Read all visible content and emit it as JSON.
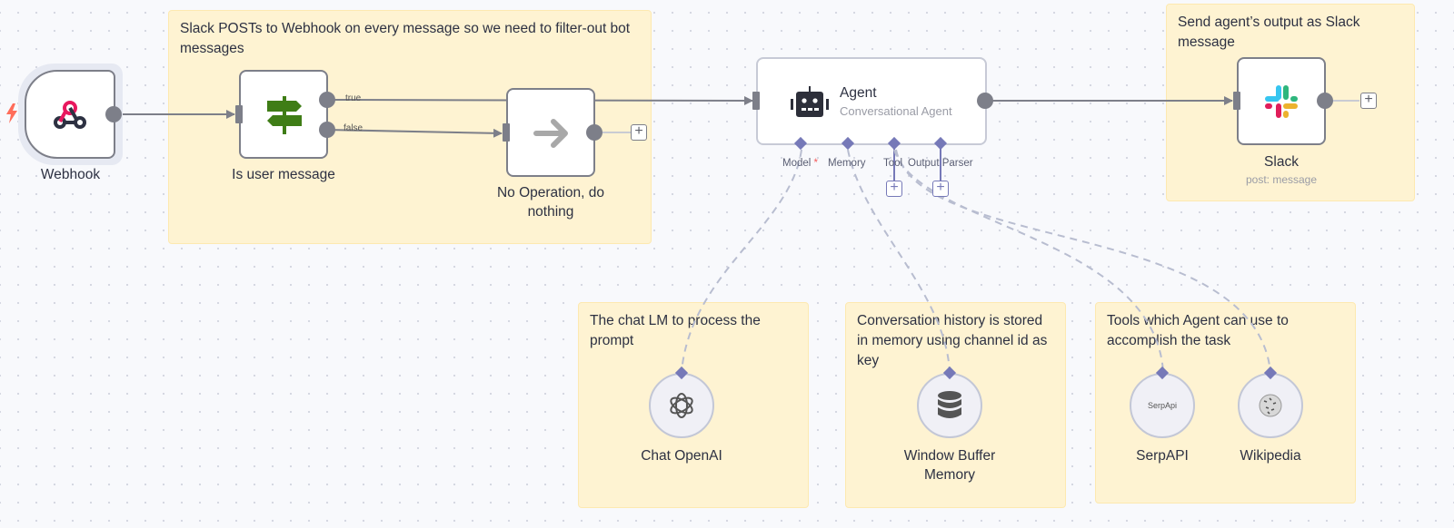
{
  "stickies": {
    "filter_note": "Slack POSTs to Webhook on every message so we need to filter-out bot messages",
    "slack_note": "Send agent’s output as Slack message",
    "model_note": "The chat LM to process the prompt",
    "memory_note": "Conversation history is stored in memory using channel id as key",
    "tools_note": "Tools which Agent can use to accomplish the task"
  },
  "nodes": {
    "webhook": {
      "label": "Webhook",
      "icon": "webhook-icon"
    },
    "if": {
      "label": "Is user message",
      "icon": "signpost-icon",
      "outputs": [
        "true",
        "false"
      ]
    },
    "noop": {
      "label": "No Operation, do nothing",
      "icon": "arrow-right-icon"
    },
    "agent": {
      "label": "Agent",
      "subtitle": "Conversational Agent",
      "icon": "robot-icon",
      "inputs": [
        {
          "label": "Model",
          "required_mark": "*"
        },
        {
          "label": "Memory"
        },
        {
          "label": "Tool"
        },
        {
          "label": "Output Parser"
        }
      ]
    },
    "slack": {
      "label": "Slack",
      "subtitle": "post: message",
      "icon": "slack-icon"
    },
    "openai": {
      "label": "Chat OpenAI",
      "icon": "openai-icon"
    },
    "memory": {
      "label": "Window Buffer Memory",
      "icon": "database-icon"
    },
    "serpapi": {
      "label": "SerpAPI",
      "icon_text": "SerpApi"
    },
    "wikipedia": {
      "label": "Wikipedia",
      "icon": "wikipedia-globe-icon"
    }
  },
  "plus_symbol": "+",
  "colors": {
    "sticky_bg": "#fef3d2",
    "edge": "#7d7f89",
    "sub_connector": "#7679b8",
    "dashed_edge": "#b8bdd0",
    "trigger": "#ff6d5a",
    "required": "#f45b5b"
  }
}
